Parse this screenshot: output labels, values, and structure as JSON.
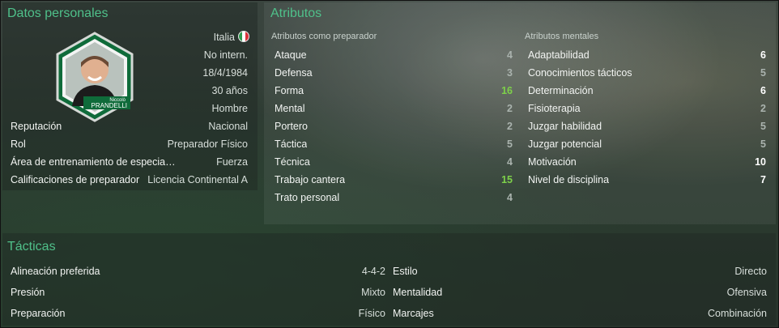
{
  "personal": {
    "title": "Datos personales",
    "nationality": "Italia",
    "international": "No intern.",
    "dob": "18/4/1984",
    "age": "30 años",
    "gender": "Hombre",
    "badge_first_name": "Niccolò",
    "badge_last_name": "PRANDELLI",
    "fields": [
      {
        "label": "Reputación",
        "value": "Nacional"
      },
      {
        "label": "Rol",
        "value": "Preparador Físico"
      },
      {
        "label": "Área de entrenamiento de especia…",
        "value": "Fuerza"
      },
      {
        "label": "Calificaciones de preparador",
        "value": "Licencia Continental A"
      }
    ]
  },
  "attributes": {
    "title": "Atributos",
    "coach_heading": "Atributos como preparador",
    "mental_heading": "Atributos mentales",
    "coach": [
      {
        "label": "Ataque",
        "value": "4"
      },
      {
        "label": "Defensa",
        "value": "3"
      },
      {
        "label": "Forma",
        "value": "16"
      },
      {
        "label": "Mental",
        "value": "2"
      },
      {
        "label": "Portero",
        "value": "2"
      },
      {
        "label": "Táctica",
        "value": "5"
      },
      {
        "label": "Técnica",
        "value": "4"
      },
      {
        "label": "Trabajo cantera",
        "value": "15"
      },
      {
        "label": "Trato personal",
        "value": "4"
      }
    ],
    "mental": [
      {
        "label": "Adaptabilidad",
        "value": "6"
      },
      {
        "label": "Conocimientos tácticos",
        "value": "5"
      },
      {
        "label": "Determinación",
        "value": "6"
      },
      {
        "label": "Fisioterapia",
        "value": "2"
      },
      {
        "label": "Juzgar habilidad",
        "value": "5"
      },
      {
        "label": "Juzgar potencial",
        "value": "5"
      },
      {
        "label": "Motivación",
        "value": "10"
      },
      {
        "label": "Nivel de disciplina",
        "value": "7"
      }
    ]
  },
  "tactics": {
    "title": "Tácticas",
    "left": [
      {
        "label": "Alineación preferida",
        "value": "4-4-2"
      },
      {
        "label": "Presión",
        "value": "Mixto"
      },
      {
        "label": "Preparación",
        "value": "Físico"
      }
    ],
    "right": [
      {
        "label": "Estilo",
        "value": "Directo"
      },
      {
        "label": "Mentalidad",
        "value": "Ofensiva"
      },
      {
        "label": "Marcajes",
        "value": "Combinación"
      }
    ]
  },
  "colors": {
    "accent": "#4fc08a",
    "highlight": "#7ed14a"
  },
  "icons": [
    "italy-flag-icon",
    "staff-portrait-badge"
  ]
}
